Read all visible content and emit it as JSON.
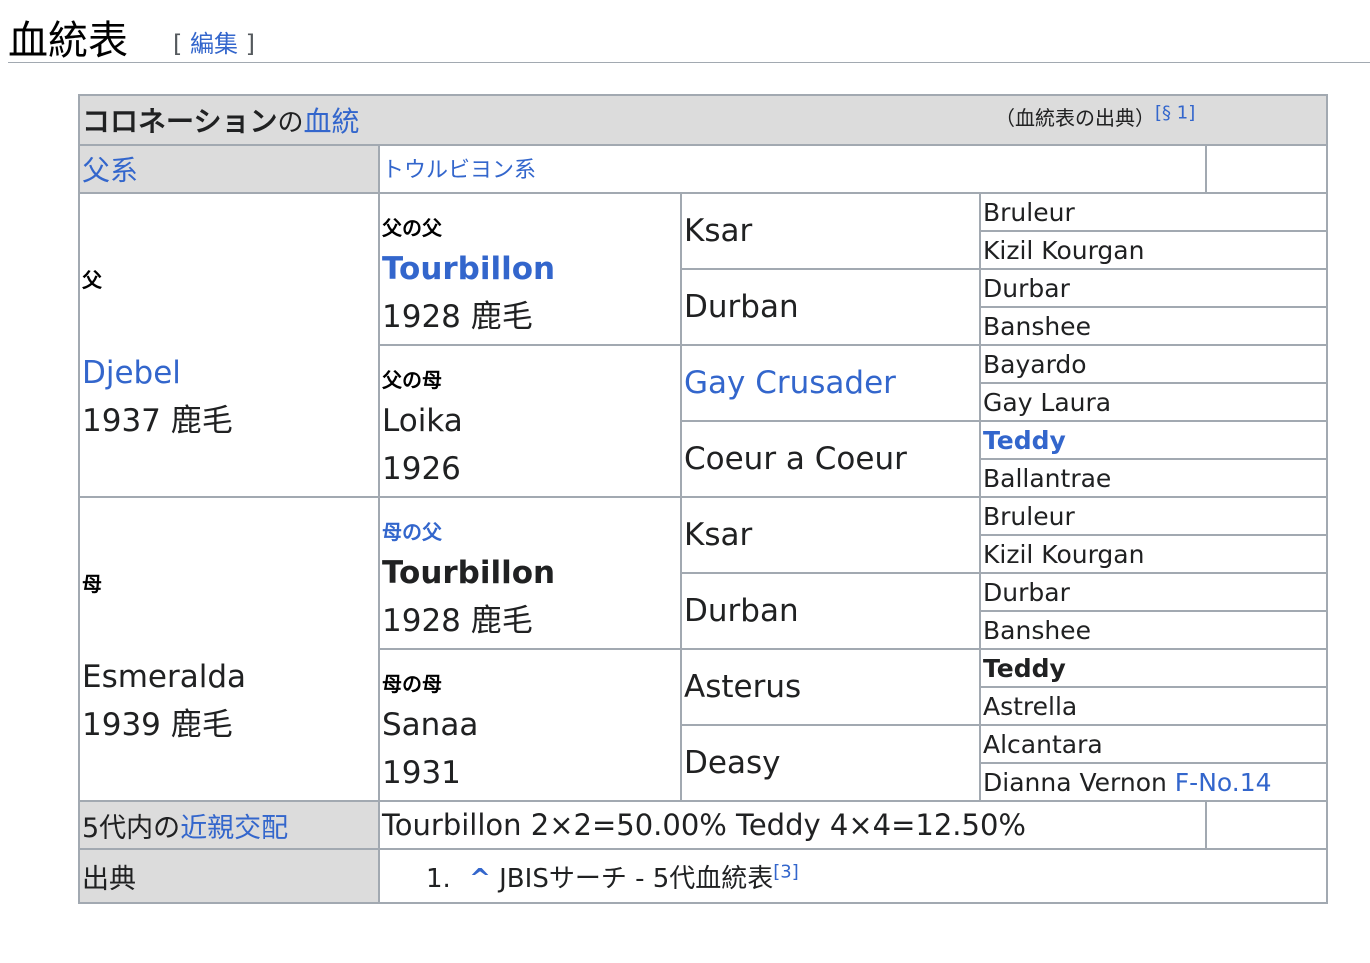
{
  "section": {
    "title": "血統表",
    "edit_open": "[",
    "edit_label": "編集",
    "edit_close": "]"
  },
  "caption": {
    "horse": "コロネーション",
    "no": "の",
    "pedigree_link": "血統",
    "source_note": "（血統表の出典）",
    "source_ref": "[§ 1]"
  },
  "sire_line": {
    "label": "父系",
    "value": "トウルビヨン系"
  },
  "sire": {
    "role": "父",
    "name": "Djebel",
    "info": "1937 鹿毛",
    "sire": {
      "role": "父の父",
      "name": "Tourbillon",
      "info": "1928 鹿毛",
      "sire": {
        "name": "Ksar",
        "sire": "Bruleur",
        "dam": "Kizil Kourgan"
      },
      "dam": {
        "name": "Durban",
        "sire": "Durbar",
        "dam": "Banshee"
      }
    },
    "dam": {
      "role": "父の母",
      "name": "Loika",
      "info": "1926",
      "sire": {
        "name": "Gay Crusader",
        "sire": "Bayardo",
        "dam": "Gay Laura"
      },
      "dam": {
        "name": "Coeur a Coeur",
        "sire": "Teddy",
        "dam": "Ballantrae"
      }
    }
  },
  "dam": {
    "role": "母",
    "name": "Esmeralda",
    "info": "1939 鹿毛",
    "sire": {
      "role": "母の父",
      "name": "Tourbillon",
      "info": "1928 鹿毛",
      "sire": {
        "name": "Ksar",
        "sire": "Bruleur",
        "dam": "Kizil Kourgan"
      },
      "dam": {
        "name": "Durban",
        "sire": "Durbar",
        "dam": "Banshee"
      }
    },
    "dam": {
      "role": "母の母",
      "name": "Sanaa",
      "info": "1931",
      "sire": {
        "name": "Asterus",
        "sire": "Teddy",
        "dam": "Astrella"
      },
      "dam": {
        "name": "Deasy",
        "sire": "Alcantara",
        "dam": "Dianna Vernon",
        "family": "F-No.14"
      }
    }
  },
  "inbreeding": {
    "label_prefix": "5代内の",
    "label_link": "近親交配",
    "value": "Tourbillon 2×2=50.00% Teddy 4×4=12.50%"
  },
  "sources": {
    "label": "出典",
    "num": "1.",
    "caret": "^",
    "text": "JBISサーチ - 5代血統表",
    "ref": "[3]"
  }
}
